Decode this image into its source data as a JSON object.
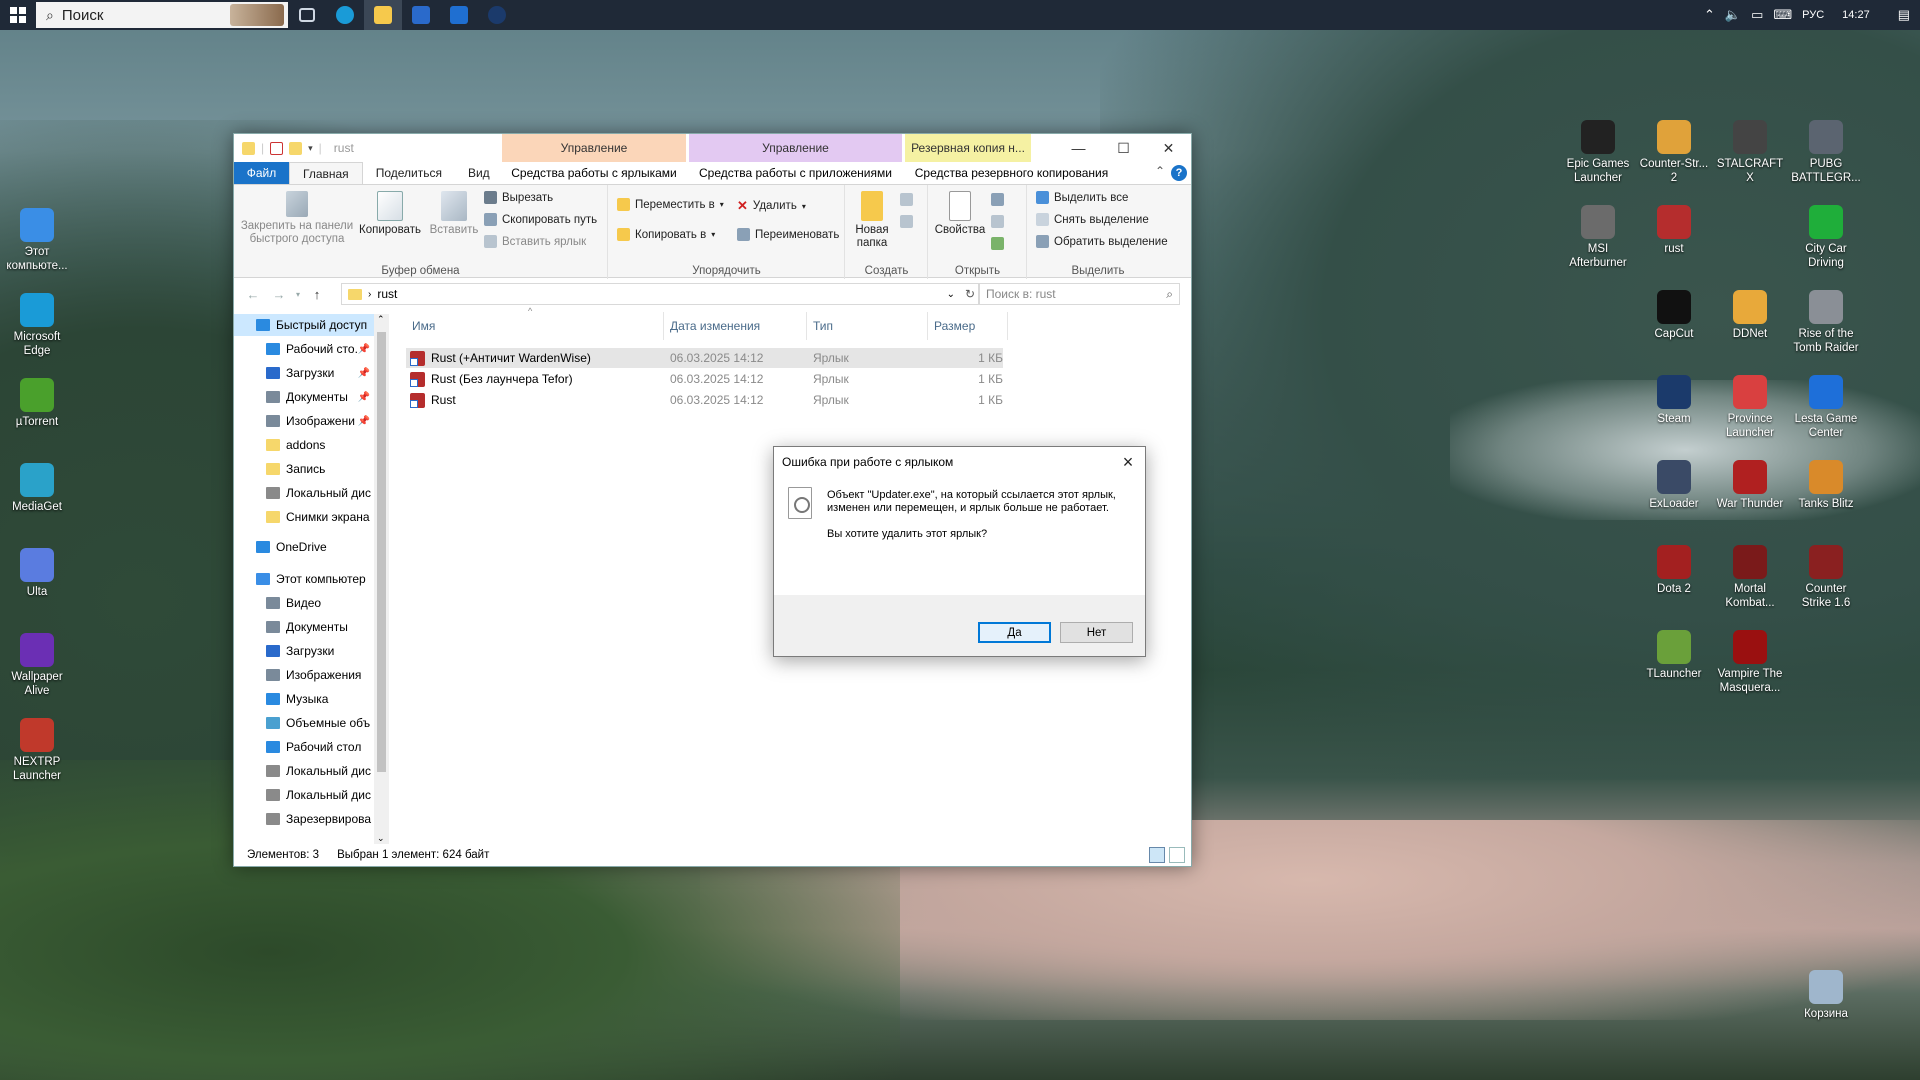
{
  "taskbar": {
    "search_placeholder": "Поиск",
    "language": "РУС",
    "time": "14:27"
  },
  "desktop_left": [
    {
      "label": "Этот компьюте...",
      "icon": "computer-icon",
      "color": "#3a8ee6"
    },
    {
      "label": "Microsoft Edge",
      "icon": "edge-icon",
      "color": "#1a9bd7"
    },
    {
      "label": "µTorrent",
      "icon": "utorrent-icon",
      "color": "#4aa02c"
    },
    {
      "label": "MediaGet",
      "icon": "mediaget-icon",
      "color": "#2aa2c9"
    },
    {
      "label": "Ulta",
      "icon": "ulta-icon",
      "color": "#5a7ce0"
    },
    {
      "label": "Wallpaper Alive",
      "icon": "wallpaper-alive-icon",
      "color": "#6b2fb4"
    },
    {
      "label": "NEXTRP Launcher",
      "icon": "nextrp-icon",
      "color": "#c0392b"
    }
  ],
  "desktop_right": [
    {
      "label": "Epic Games Launcher",
      "icon": "epic-games-icon",
      "color": "#222222"
    },
    {
      "label": "Counter-Str... 2",
      "icon": "cs2-icon",
      "color": "#e0a23a"
    },
    {
      "label": "STALCRAFT X",
      "icon": "stalcraft-icon",
      "color": "#444444"
    },
    {
      "label": "PUBG BATTLEGR...",
      "icon": "pubg-icon",
      "color": "#5b6470"
    },
    {
      "label": "MSI Afterburner",
      "icon": "msi-afterburner-icon",
      "color": "#6b6b6b"
    },
    {
      "label": "rust",
      "icon": "rust-icon",
      "color": "#b52d2d"
    },
    {
      "label": "City Car Driving",
      "icon": "city-car-driving-icon",
      "color": "#1fae3a"
    },
    {
      "label": "CapCut",
      "icon": "capcut-icon",
      "color": "#111111"
    },
    {
      "label": "DDNet",
      "icon": "ddnet-icon",
      "color": "#e8a93a"
    },
    {
      "label": "Rise of the Tomb Raider",
      "icon": "tomb-raider-icon",
      "color": "#8a8f96"
    },
    {
      "label": "Steam",
      "icon": "steam-icon",
      "color": "#1b3a6b"
    },
    {
      "label": "Province Launcher",
      "icon": "province-icon",
      "color": "#d94040"
    },
    {
      "label": "Lesta Game Center",
      "icon": "lesta-icon",
      "color": "#1e6fd9"
    },
    {
      "label": "ExLoader",
      "icon": "exloader-icon",
      "color": "#3a4a66"
    },
    {
      "label": "War Thunder",
      "icon": "war-thunder-icon",
      "color": "#b02020"
    },
    {
      "label": "Tanks Blitz",
      "icon": "tanks-blitz-icon",
      "color": "#d98a2a"
    },
    {
      "label": "Dota 2",
      "icon": "dota2-icon",
      "color": "#a32020"
    },
    {
      "label": "Mortal Kombat...",
      "icon": "mortal-kombat-icon",
      "color": "#7a1a1a"
    },
    {
      "label": "Counter Strike 1.6",
      "icon": "cs16-icon",
      "color": "#8a2020"
    },
    {
      "label": "TLauncher",
      "icon": "tlauncher-icon",
      "color": "#6aa03a"
    },
    {
      "label": "Vampire The Masquera...",
      "icon": "vampire-icon",
      "color": "#9a1010"
    },
    {
      "label": "Корзина",
      "icon": "recycle-bin-icon",
      "color": "#9fb6cc"
    }
  ],
  "explorer": {
    "title": "rust",
    "ctx1_header": "Управление",
    "ctx2_header": "Управление",
    "ctx3_header": "Резервная копия н...",
    "tabs": {
      "file": "Файл",
      "home": "Главная",
      "share": "Поделиться",
      "view": "Вид",
      "ctx1": "Средства работы с ярлыками",
      "ctx2": "Средства работы с приложениями",
      "ctx3": "Средства резервного копирования"
    },
    "ribbon": {
      "pin": "Закрепить на панели быстрого доступа",
      "copy": "Копировать",
      "paste": "Вставить",
      "cut": "Вырезать",
      "copy_path": "Скопировать путь",
      "paste_shortcut": "Вставить ярлык",
      "group_clipboard": "Буфер обмена",
      "move_to": "Переместить в",
      "copy_to": "Копировать в",
      "delete": "Удалить",
      "rename": "Переименовать",
      "group_organize": "Упорядочить",
      "new_folder": "Новая папка",
      "group_new": "Создать",
      "properties": "Свойства",
      "group_open": "Открыть",
      "select_all": "Выделить все",
      "select_none": "Снять выделение",
      "invert": "Обратить выделение",
      "group_select": "Выделить"
    },
    "address": "rust",
    "search_placeholder": "Поиск в: rust",
    "nav": [
      {
        "label": "Быстрый доступ",
        "color": "#2a8ae0",
        "pin": false,
        "indent": 0
      },
      {
        "label": "Рабочий сто.",
        "color": "#2a8ae0",
        "pin": true,
        "indent": 1
      },
      {
        "label": "Загрузки",
        "color": "#2a6acb",
        "pin": true,
        "indent": 1
      },
      {
        "label": "Документы",
        "color": "#7a8a9a",
        "pin": true,
        "indent": 1
      },
      {
        "label": "Изображени",
        "color": "#7a8a9a",
        "pin": true,
        "indent": 1
      },
      {
        "label": "addons",
        "color": "#f6d76b",
        "pin": false,
        "indent": 1
      },
      {
        "label": "Запись",
        "color": "#f6d76b",
        "pin": false,
        "indent": 1
      },
      {
        "label": "Локальный дис",
        "color": "#8a8a8a",
        "pin": false,
        "indent": 1
      },
      {
        "label": "Снимки экрана",
        "color": "#f6d76b",
        "pin": false,
        "indent": 1
      },
      {
        "label": "OneDrive",
        "color": "#2a8ae0",
        "pin": false,
        "indent": 0
      },
      {
        "label": "Этот компьютер",
        "color": "#3a8ee6",
        "pin": false,
        "indent": 0
      },
      {
        "label": "Видео",
        "color": "#7a8a9a",
        "pin": false,
        "indent": 1
      },
      {
        "label": "Документы",
        "color": "#7a8a9a",
        "pin": false,
        "indent": 1
      },
      {
        "label": "Загрузки",
        "color": "#2a6acb",
        "pin": false,
        "indent": 1
      },
      {
        "label": "Изображения",
        "color": "#7a8a9a",
        "pin": false,
        "indent": 1
      },
      {
        "label": "Музыка",
        "color": "#2a8ae0",
        "pin": false,
        "indent": 1
      },
      {
        "label": "Объемные объ",
        "color": "#4aa0d0",
        "pin": false,
        "indent": 1
      },
      {
        "label": "Рабочий стол",
        "color": "#2a8ae0",
        "pin": false,
        "indent": 1
      },
      {
        "label": "Локальный дис",
        "color": "#8a8a8a",
        "pin": false,
        "indent": 1
      },
      {
        "label": "Локальный дис",
        "color": "#8a8a8a",
        "pin": false,
        "indent": 1
      },
      {
        "label": "Зарезервирова",
        "color": "#8a8a8a",
        "pin": false,
        "indent": 1
      }
    ],
    "columns": {
      "name": "Имя",
      "date": "Дата изменения",
      "type": "Тип",
      "size": "Размер"
    },
    "files": [
      {
        "name": "Rust (+Античит WardenWise)",
        "date": "06.03.2025 14:12",
        "type": "Ярлык",
        "size": "1 КБ",
        "selected": true
      },
      {
        "name": "Rust (Без лаунчера Tefor)",
        "date": "06.03.2025 14:12",
        "type": "Ярлык",
        "size": "1 КБ",
        "selected": false
      },
      {
        "name": "Rust",
        "date": "06.03.2025 14:12",
        "type": "Ярлык",
        "size": "1 КБ",
        "selected": false
      }
    ],
    "status_count": "Элементов: 3",
    "status_selected": "Выбран 1 элемент: 624 байт"
  },
  "dialog": {
    "title": "Ошибка при работе с ярлыком",
    "message": "Объект \"Updater.exe\", на который ссылается этот ярлык, изменен или перемещен, и ярлык больше не работает.",
    "question": "Вы хотите удалить этот ярлык?",
    "yes": "Да",
    "no": "Нет"
  }
}
